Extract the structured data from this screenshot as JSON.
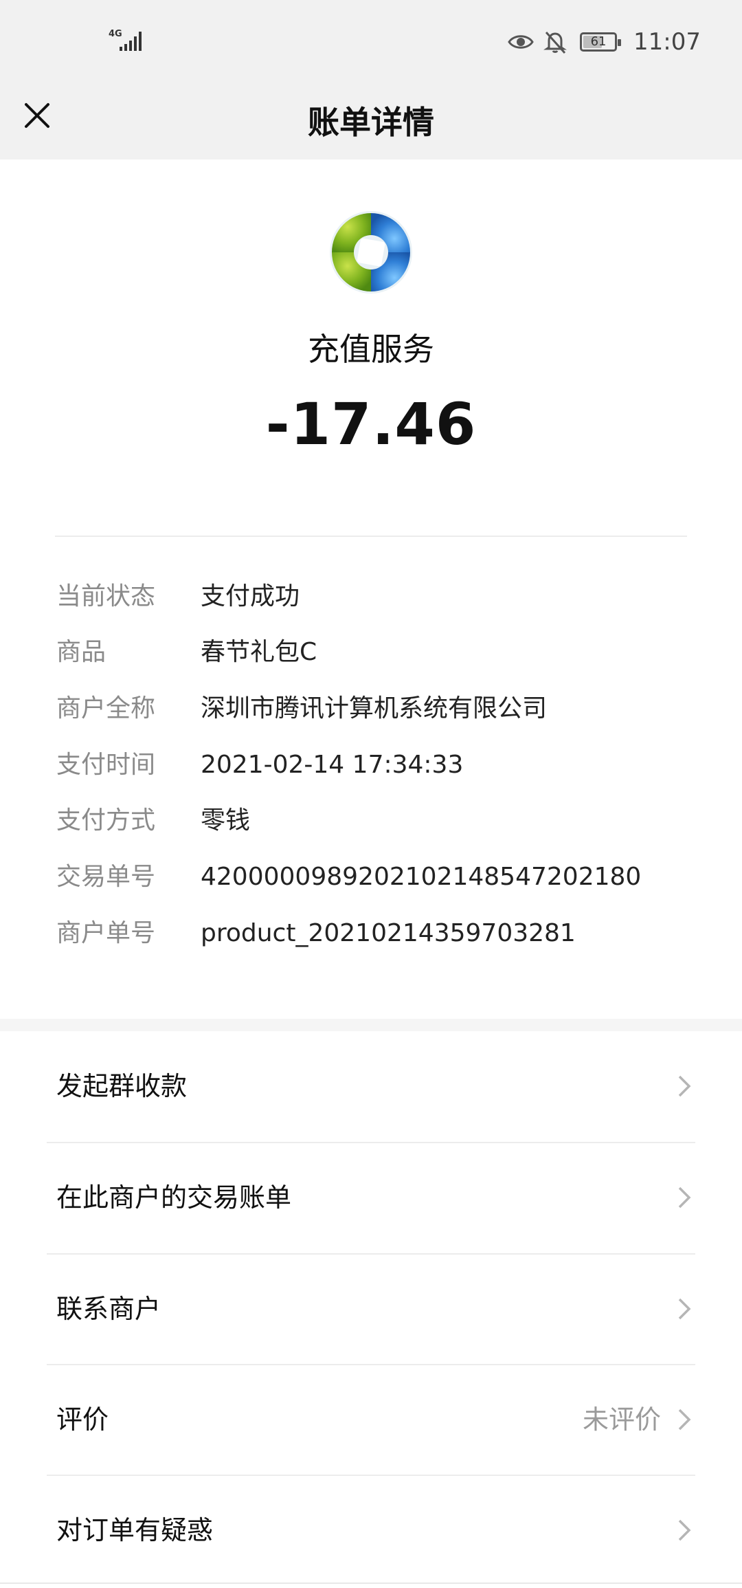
{
  "status_bar": {
    "network": "4G",
    "battery": {
      "level_text": "61",
      "level_fraction": 0.61
    },
    "time": "11:07",
    "icons": [
      "signal-icon",
      "eye-icon",
      "notifications-off-icon",
      "battery-icon"
    ]
  },
  "nav": {
    "title": "账单详情",
    "close_icon": "close-icon"
  },
  "header": {
    "logo_icon": "merchant-logo-icon",
    "merchant": "充值服务",
    "amount": "-17.46"
  },
  "details": [
    {
      "label": "当前状态",
      "value": "支付成功"
    },
    {
      "label": "商品",
      "value": "春节礼包C"
    },
    {
      "label": "商户全称",
      "value": "深圳市腾讯计算机系统有限公司"
    },
    {
      "label": "支付时间",
      "value": "2021-02-14 17:34:33"
    },
    {
      "label": "支付方式",
      "value": "零钱"
    },
    {
      "label": "交易单号",
      "value": "4200000989202102148547202180"
    },
    {
      "label": "商户单号",
      "value": "product_20210214359703281"
    }
  ],
  "actions": [
    {
      "label": "发起群收款",
      "extra": ""
    },
    {
      "label": "在此商户的交易账单",
      "extra": ""
    },
    {
      "label": "联系商户",
      "extra": ""
    },
    {
      "label": "评价",
      "extra": "未评价"
    },
    {
      "label": "对订单有疑惑",
      "extra": ""
    }
  ],
  "colors": {
    "bar_background": "#f1f1f1",
    "label_gray": "#8a8a8a",
    "text_primary": "#111111"
  }
}
